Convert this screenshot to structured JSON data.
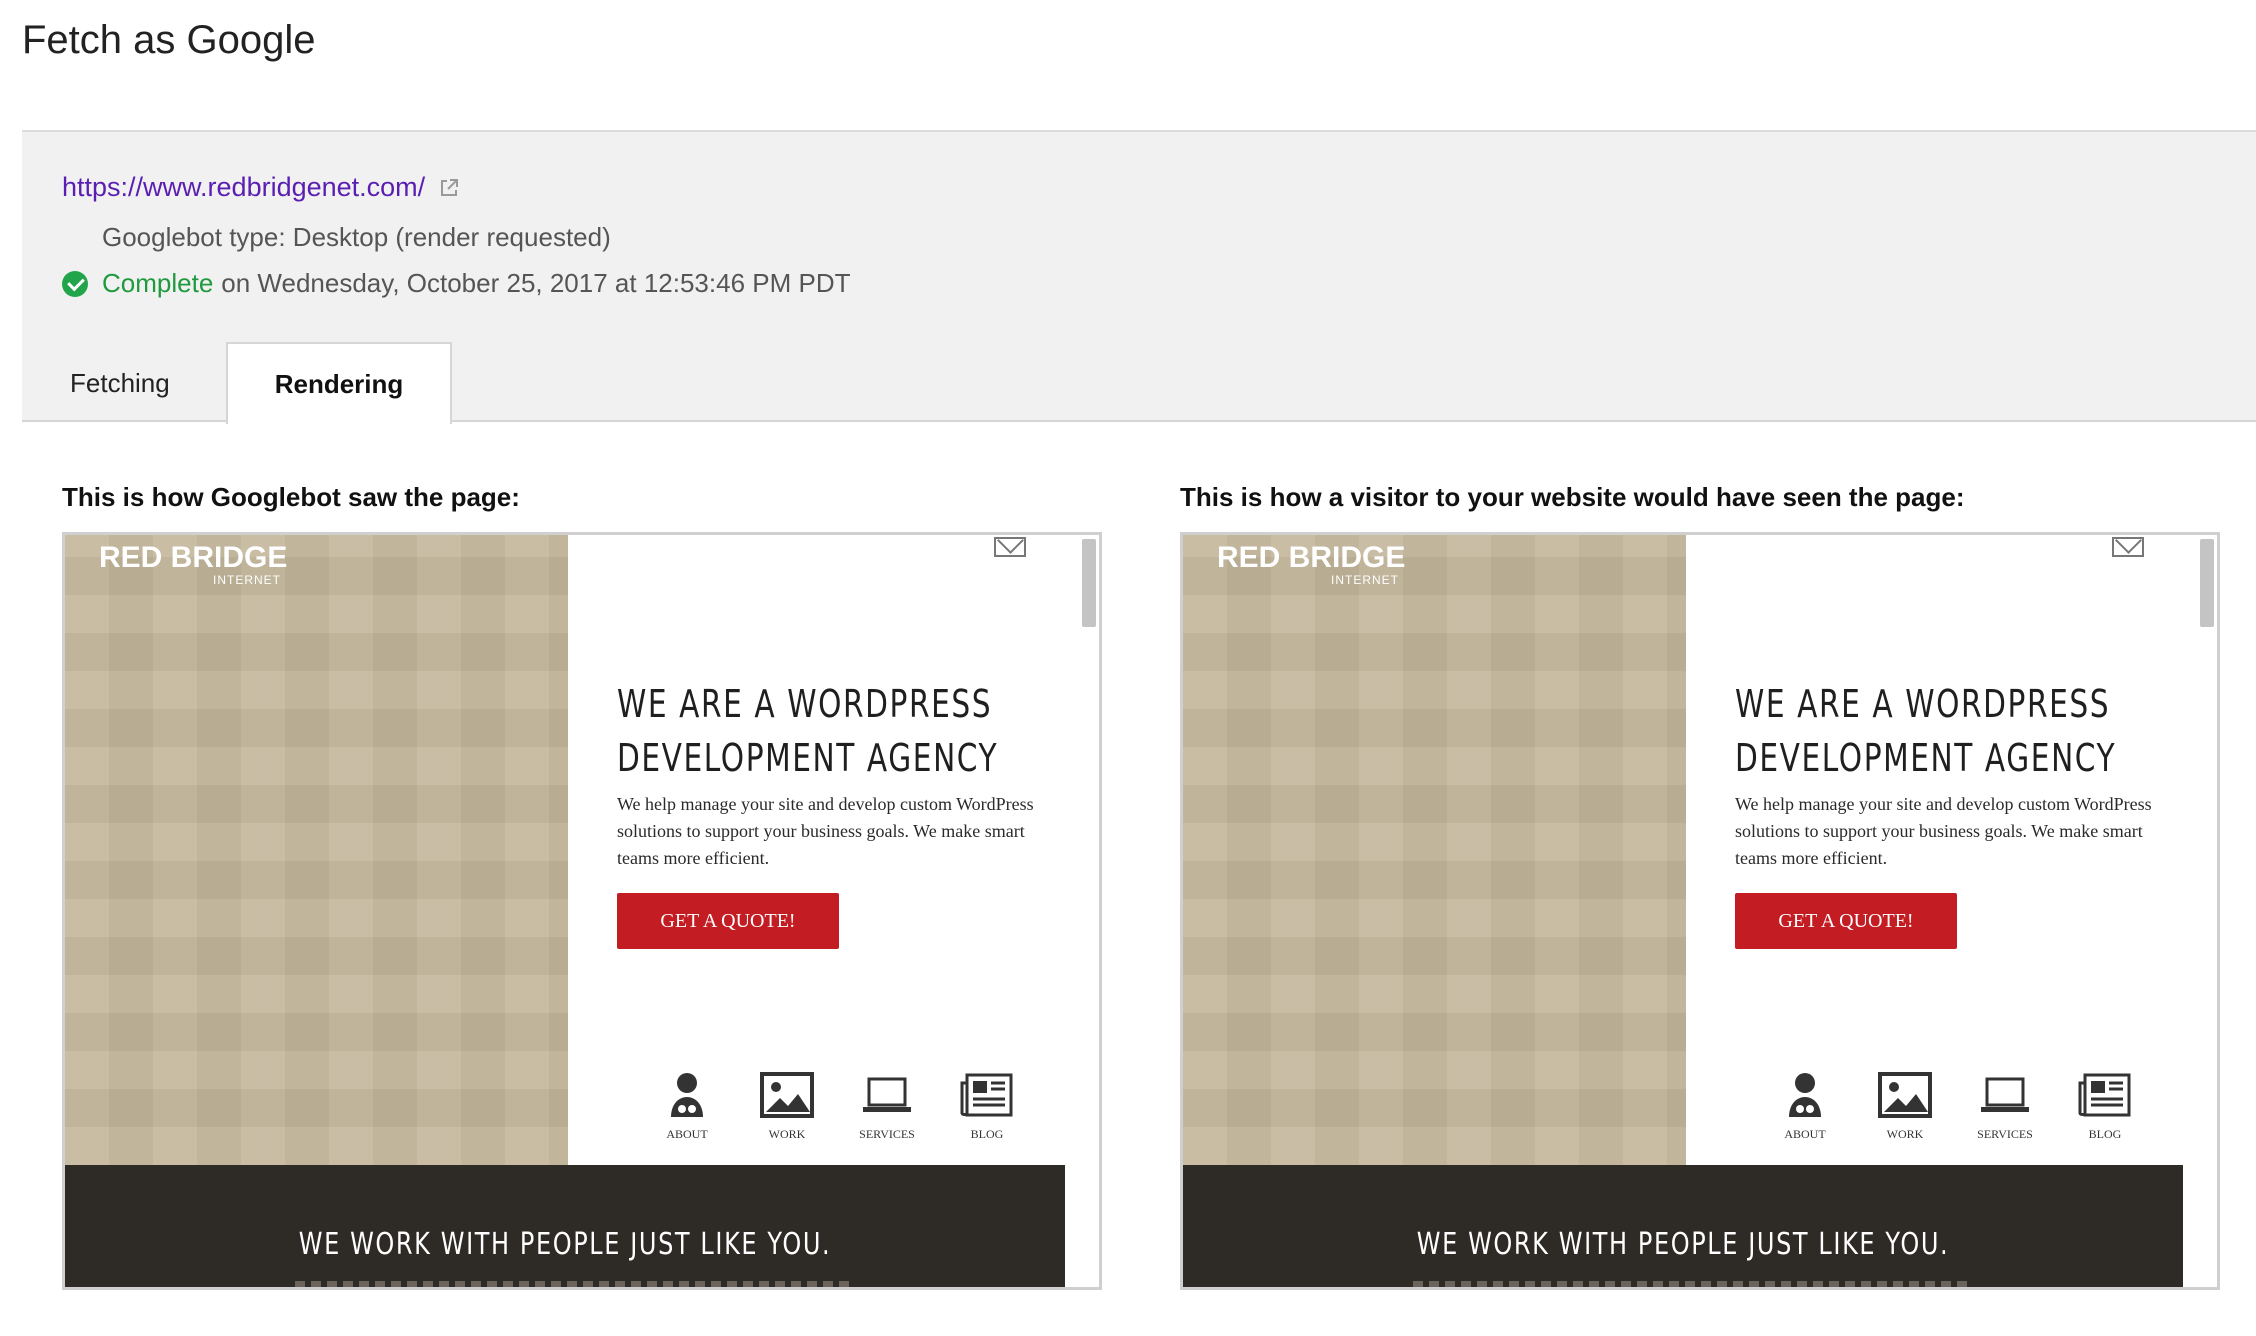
{
  "page": {
    "title": "Fetch as Google"
  },
  "status": {
    "url": "https://www.redbridgenet.com/",
    "bot_type": "Googlebot type: Desktop (render requested)",
    "complete_word": "Complete",
    "complete_rest": "on Wednesday, October 25, 2017 at 12:53:46 PM PDT",
    "status_color": "#1f9a3f"
  },
  "tabs": [
    {
      "label": "Fetching",
      "active": false
    },
    {
      "label": "Rendering",
      "active": true
    }
  ],
  "panels": {
    "googlebot_caption": "This is how Googlebot saw the page:",
    "visitor_caption": "This is how a visitor to your website would have seen the page:"
  },
  "site": {
    "logo": "RED BRIDGE",
    "logo_sub": "INTERNET",
    "heading_line1": "WE ARE A WORDPRESS",
    "heading_line2": "DEVELOPMENT AGENCY",
    "paragraph": "We help manage your site and develop custom WordPress solutions to support your business goals. We make smart teams more efficient.",
    "cta": "GET A QUOTE!",
    "nav": [
      {
        "label": "ABOUT",
        "icon": "person-icon"
      },
      {
        "label": "WORK",
        "icon": "image-icon"
      },
      {
        "label": "SERVICES",
        "icon": "laptop-icon"
      },
      {
        "label": "BLOG",
        "icon": "newspaper-icon"
      }
    ],
    "band_text": "WE WORK WITH PEOPLE JUST LIKE YOU.",
    "accent": "#c41c23",
    "sidebar_color": "#c4b79c",
    "band_color": "#2e2a26"
  }
}
